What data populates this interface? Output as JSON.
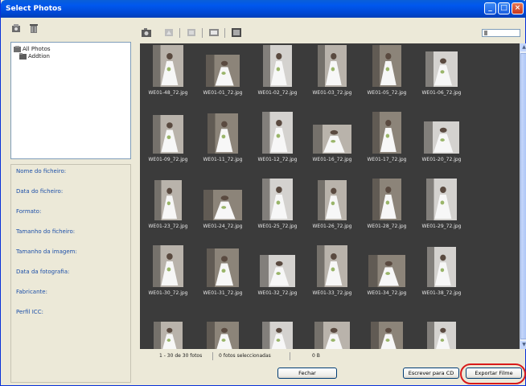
{
  "window": {
    "title": "Select Photos"
  },
  "tree": {
    "root": "All Photos",
    "child": "Addtion"
  },
  "properties": [
    "Nome do ficheiro:",
    "Data do ficheiro:",
    "Formato:",
    "Tamanho do ficheiro:",
    "Tamanho da imagem:",
    "Data da fotografia:",
    "Fabricante:",
    "Perfil ICC:"
  ],
  "photos": [
    "WE01-48_72.jpg",
    "WE01-01_72.jpg",
    "WE01-02_72.jpg",
    "WE01-03_72.jpg",
    "WE01-05_72.jpg",
    "WE01-06_72.jpg",
    "WE01-09_72.jpg",
    "WE01-11_72.jpg",
    "WE01-12_72.jpg",
    "WE01-16_72.jpg",
    "WE01-17_72.jpg",
    "WE01-20_72.jpg",
    "WE01-23_72.jpg",
    "WE01-24_72.jpg",
    "WE01-25_72.jpg",
    "WE01-26_72.jpg",
    "WE01-28_72.jpg",
    "WE01-29_72.jpg",
    "WE01-30_72.jpg",
    "WE01-31_72.jpg",
    "WE01-32_72.jpg",
    "WE01-33_72.jpg",
    "WE01-34_72.jpg",
    "WE01-38_72.jpg",
    "",
    "",
    "",
    "",
    "",
    ""
  ],
  "status": {
    "range": "1 - 30 de 30 fotos",
    "selected": "0 fotos seleccionadas",
    "size": "0 B"
  },
  "buttons": {
    "close": "Fechar",
    "burn_cd": "Escrever para CD",
    "export": "Exportar Filme"
  },
  "colors": {
    "title_bar": "#0058ee",
    "gallery_bg": "#3b3b3b",
    "highlight_ring": "#d81a1a"
  }
}
